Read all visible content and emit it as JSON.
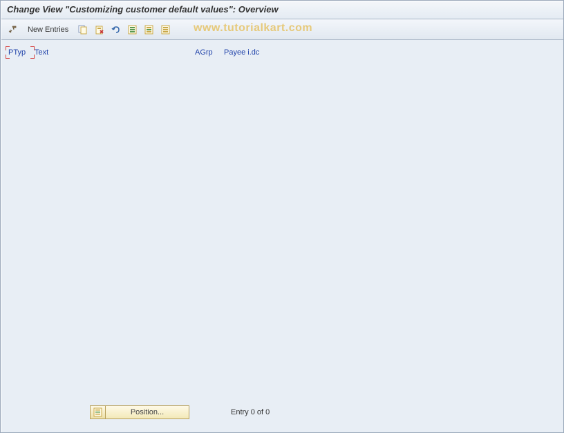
{
  "title": "Change View \"Customizing customer default values\": Overview",
  "toolbar": {
    "new_entries_label": "New Entries"
  },
  "watermark": "www.tutorialkart.com",
  "columns": {
    "ptyp": "PTyp",
    "text": "Text",
    "agrp": "AGrp",
    "payee": "Payee i.dc"
  },
  "bottom": {
    "position_label": "Position...",
    "entry_text": "Entry 0 of 0"
  }
}
